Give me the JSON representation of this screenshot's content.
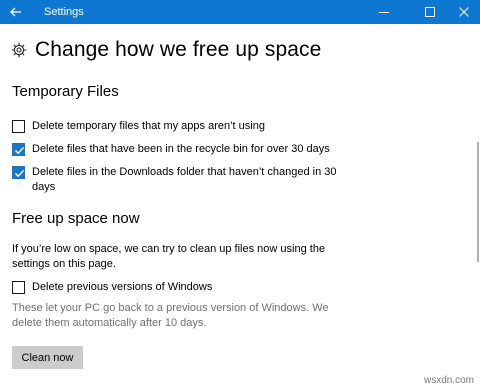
{
  "window": {
    "title": "Settings",
    "back_icon": "arrow-left-icon",
    "controls": [
      "minimize-icon",
      "maximize-icon",
      "close-icon"
    ]
  },
  "page": {
    "icon": "gear-icon",
    "title": "Change how we free up space"
  },
  "temporary_files": {
    "heading": "Temporary Files",
    "options": [
      {
        "label": "Delete temporary files that my apps aren’t using",
        "checked": false
      },
      {
        "label": "Delete files that have been in the recycle bin for over 30 days",
        "checked": true
      },
      {
        "label": "Delete files in the Downloads folder that haven’t changed in 30 days",
        "checked": true
      }
    ]
  },
  "free_up_now": {
    "heading": "Free up space now",
    "description": "If you’re low on space, we can try to clean up files now using the settings on this page.",
    "option": {
      "label": "Delete previous versions of Windows",
      "checked": false
    },
    "note": "These let your PC go back to a previous version of Windows. We delete them automatically after 10 days.",
    "button_label": "Clean now"
  },
  "watermark": "wsxdn.com",
  "colors": {
    "titlebar": "#0e77d1",
    "checkbox_checked": "#1776c6",
    "button": "#cccccc",
    "muted_text": "#707070"
  }
}
